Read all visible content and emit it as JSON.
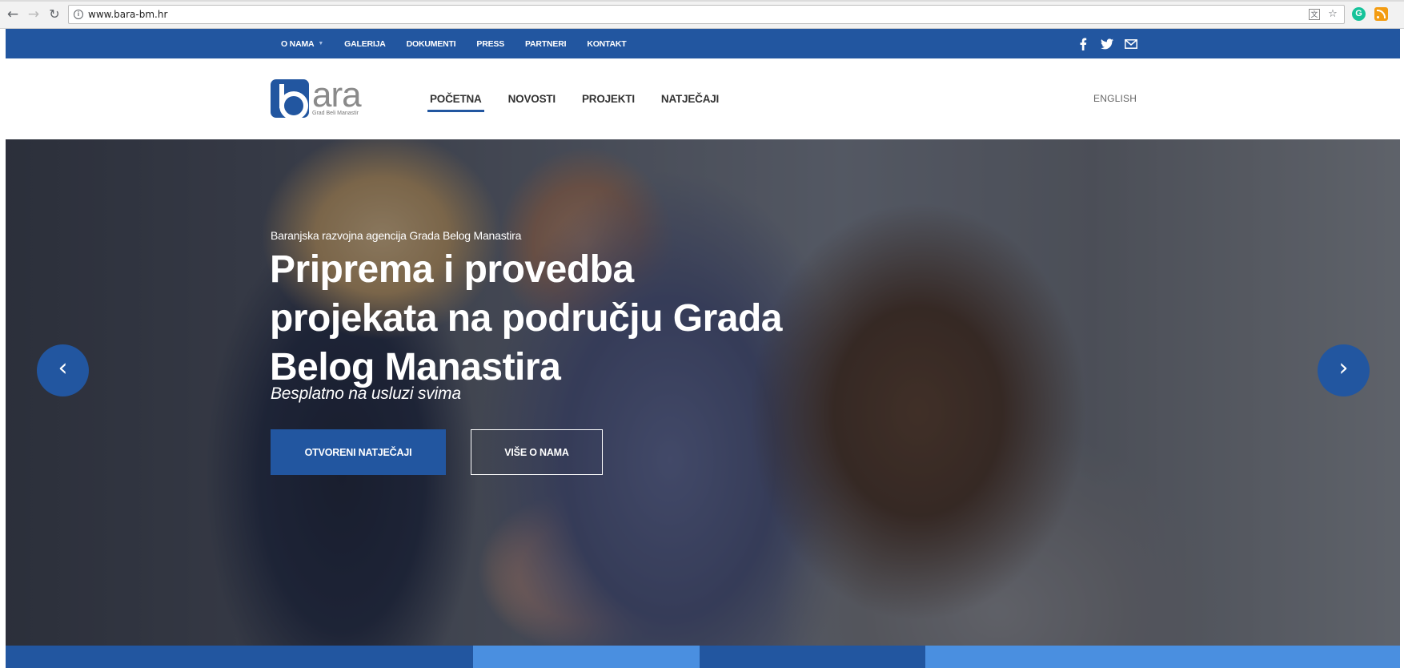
{
  "browser": {
    "url": "www.bara-bm.hr"
  },
  "topbar": {
    "items": [
      {
        "label": "O NAMA",
        "has_dropdown": true
      },
      {
        "label": "GALERIJA"
      },
      {
        "label": "DOKUMENTI"
      },
      {
        "label": "PRESS"
      },
      {
        "label": "PARTNERI"
      },
      {
        "label": "KONTAKT"
      }
    ],
    "social": [
      "facebook-icon",
      "twitter-icon",
      "mail-icon"
    ],
    "color": "#2256a0"
  },
  "header": {
    "logo_text": "ara",
    "logo_subtitle": "Grad Beli Manastir",
    "nav": [
      {
        "label": "POČETNA",
        "active": true
      },
      {
        "label": "NOVOSTI"
      },
      {
        "label": "PROJEKTI"
      },
      {
        "label": "NATJEČAJI"
      }
    ],
    "language": "ENGLISH"
  },
  "hero": {
    "tagline": "Baranjska razvojna agencija Grada Belog Manastira",
    "headline": "Priprema i provedba projekata na području Grada Belog Manastira",
    "subline": "Besplatno na usluzi svima",
    "primary_button": "OTVORENI NATJEČAJI",
    "secondary_button": "VIŠE O NAMA",
    "prev_arrow": "‹",
    "next_arrow": "›"
  },
  "strip_colors": [
    "#2256a0",
    "#4a8fe0",
    "#2256a0",
    "#4a8fe0"
  ]
}
